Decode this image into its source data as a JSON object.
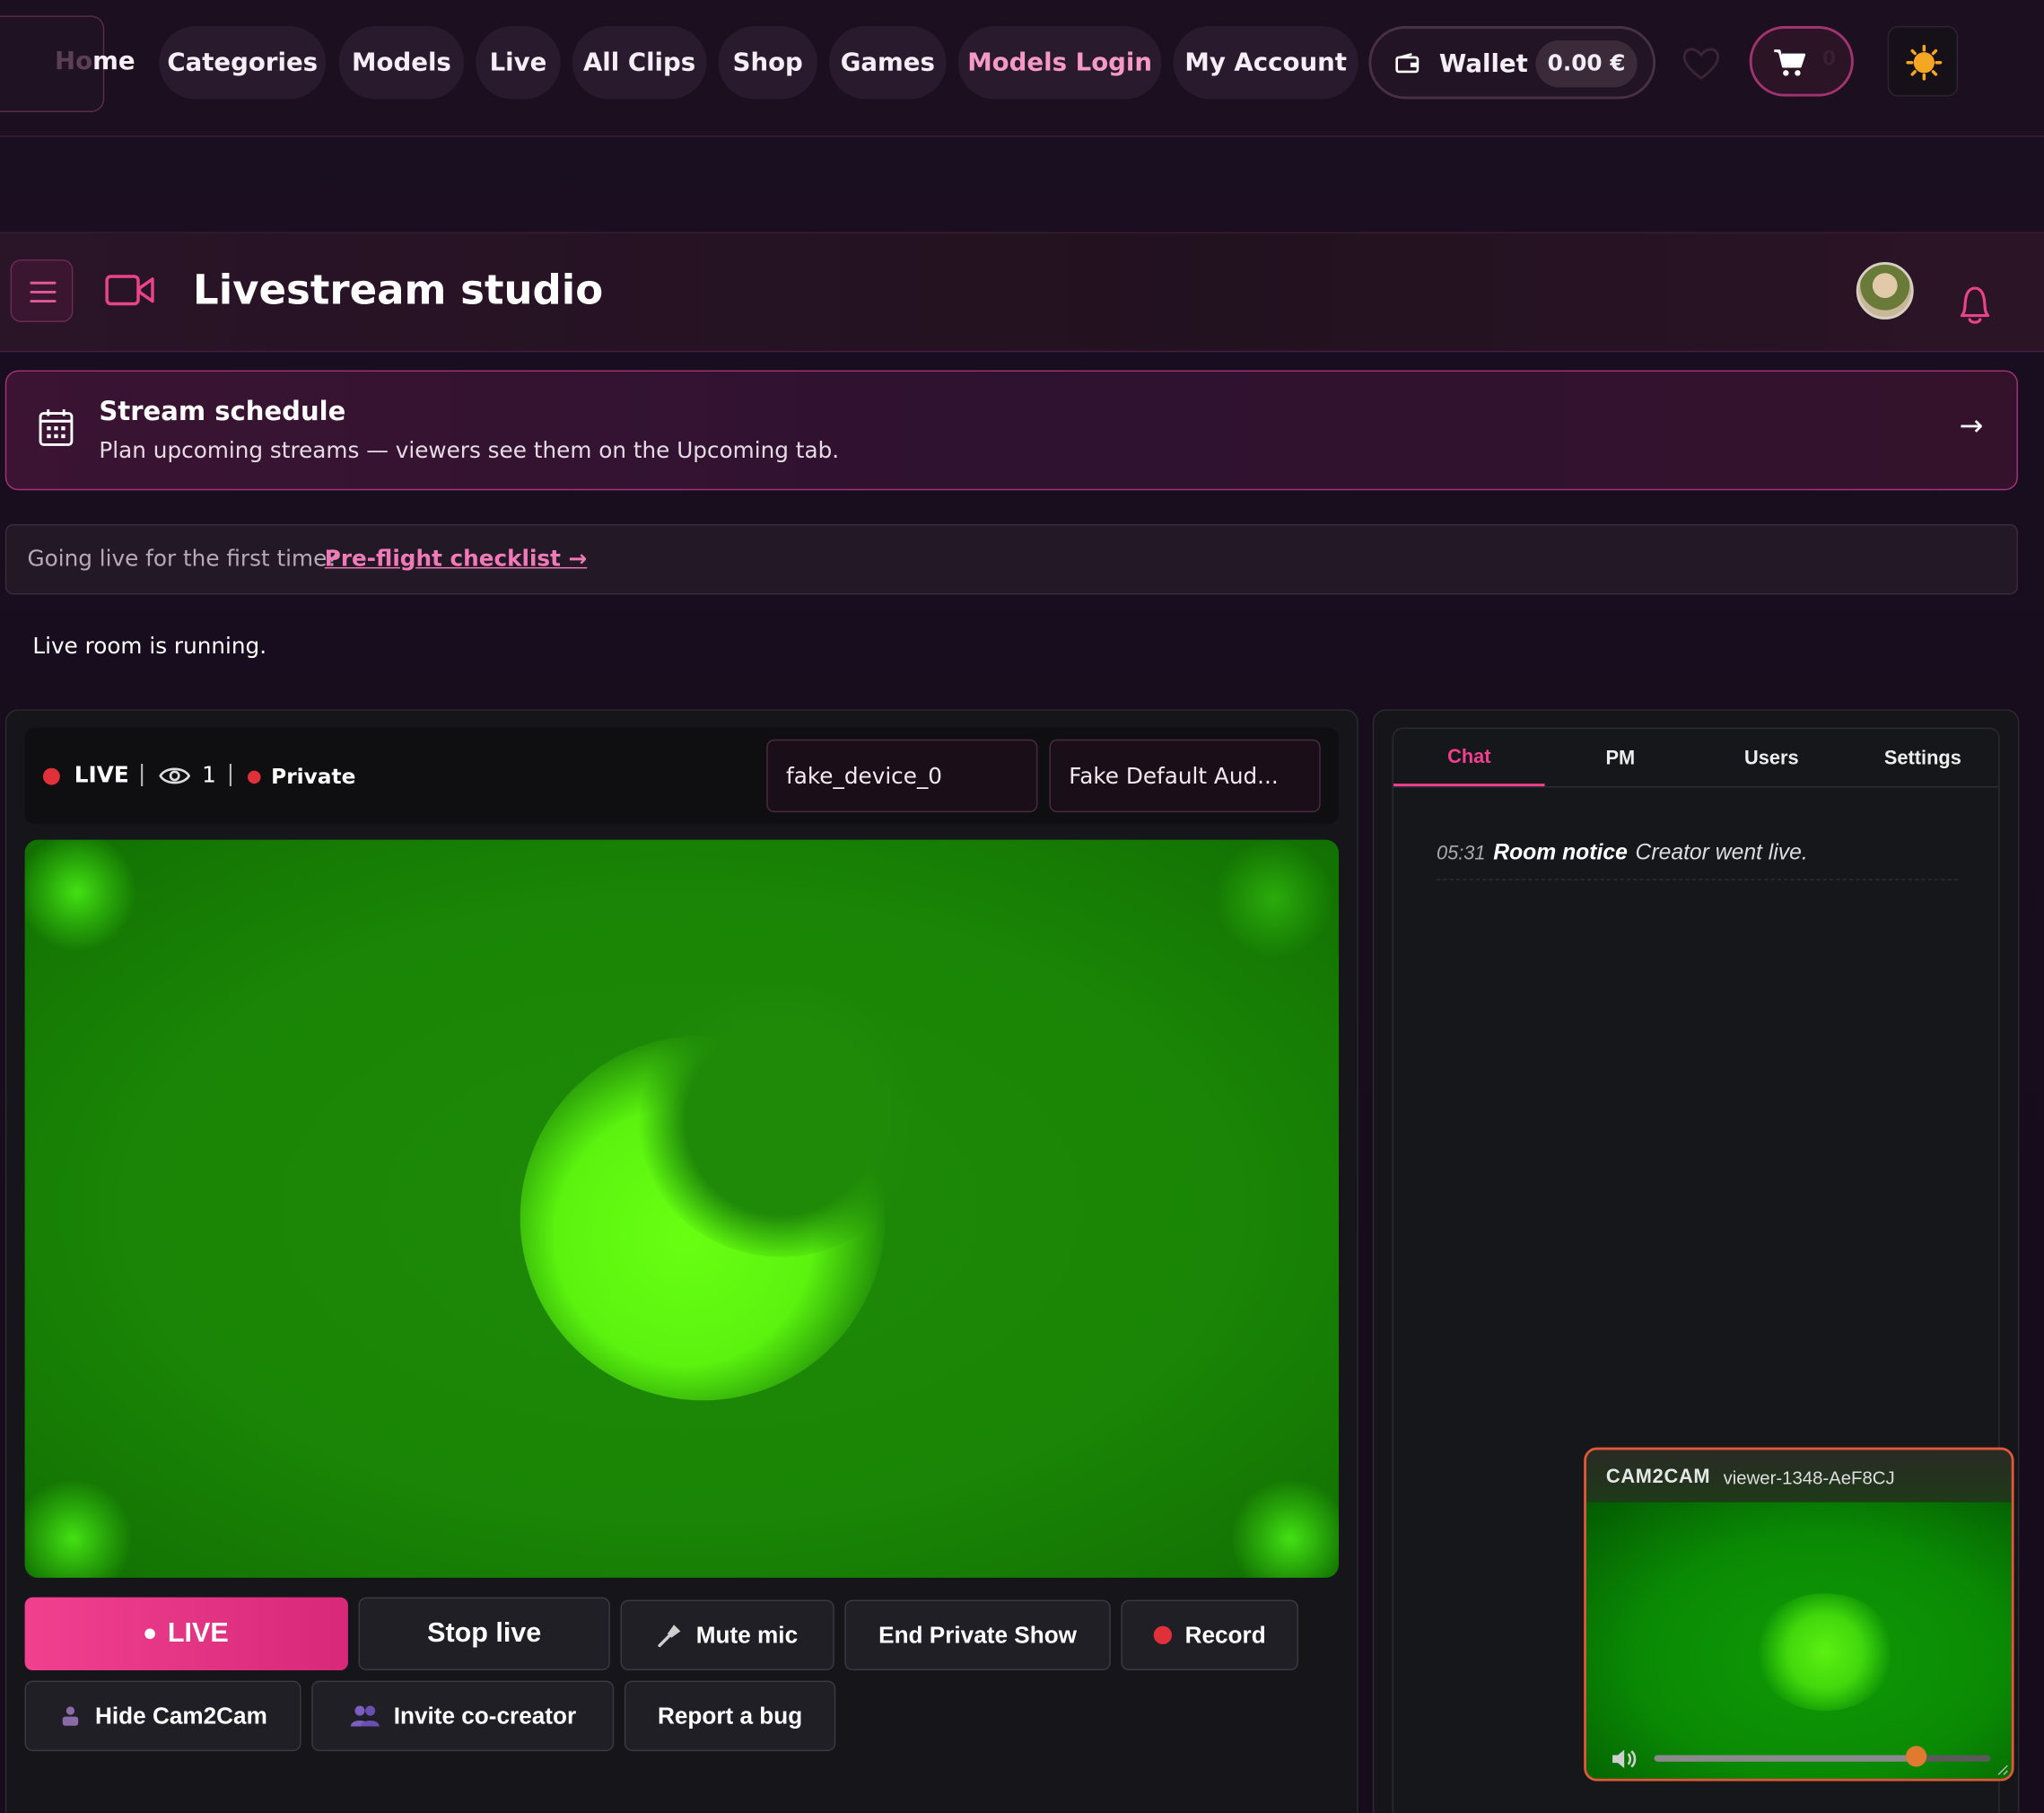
{
  "nav": {
    "home": "Home",
    "items": [
      {
        "label": "Categories"
      },
      {
        "label": "Models"
      },
      {
        "label": "Live"
      },
      {
        "label": "All Clips"
      },
      {
        "label": "Shop"
      },
      {
        "label": "Games"
      },
      {
        "label": "Models Login"
      },
      {
        "label": "My Account"
      }
    ],
    "wallet_label": "Wallet",
    "wallet_amount": "0.00 €",
    "cart_count": "0",
    "icons": [
      "wallet-icon",
      "heart-icon",
      "cart-icon",
      "sun-icon"
    ],
    "accent": "#f49ac6"
  },
  "header": {
    "title": "Livestream studio",
    "icons": [
      "menu-icon",
      "video-camera-icon",
      "avatar",
      "bell-icon"
    ]
  },
  "schedule": {
    "title": "Stream schedule",
    "subtitle": "Plan upcoming streams — viewers see them on the Upcoming tab.",
    "arrow": "→"
  },
  "checklist": {
    "text": "Going live for the first time?",
    "link": "Pre-flight checklist →"
  },
  "room_status": "Live room is running.",
  "statusbar": {
    "live": "LIVE",
    "separator": "|",
    "viewers": "1",
    "mode": "Private",
    "video_device": "fake_device_0",
    "audio_device": "Fake Default Aud..."
  },
  "controls": {
    "live": "LIVE",
    "stop_live": "Stop live",
    "mute_mic": "Mute mic",
    "end_private": "End Private Show",
    "record": "Record",
    "hide_cam2cam": "Hide Cam2Cam",
    "invite": "Invite co-creator",
    "report_bug": "Report a bug"
  },
  "chat": {
    "tabs": [
      {
        "label": "Chat",
        "active": true
      },
      {
        "label": "PM",
        "active": false
      },
      {
        "label": "Users",
        "active": false
      },
      {
        "label": "Settings",
        "active": false
      }
    ],
    "messages": [
      {
        "time": "05:31",
        "author": "Room notice",
        "text": "Creator went live."
      }
    ]
  },
  "cam2cam": {
    "tag": "CAM2CAM",
    "viewer": "viewer-1348-AeF8CJ",
    "volume": 0.78
  },
  "colors": {
    "accent_pink": "#f0408e",
    "live_red": "#e0303a",
    "video_green": "#1a8506",
    "cam2cam_border": "#e0583a"
  }
}
